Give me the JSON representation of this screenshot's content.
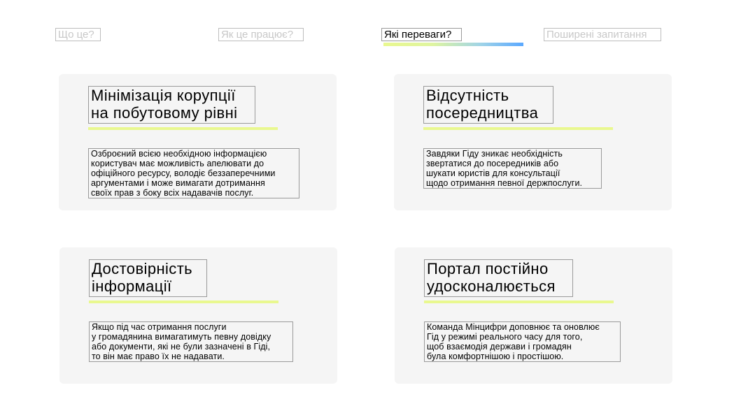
{
  "nav": {
    "tabs": [
      {
        "label": "Що це?",
        "active": false
      },
      {
        "label": "Як це працює?",
        "active": false
      },
      {
        "label": "Які переваги?",
        "active": true
      },
      {
        "label": "Поширені запитання",
        "active": false
      }
    ],
    "active_gradient": [
      "#e9f88f",
      "#5aa8ff"
    ]
  },
  "cards": [
    {
      "title_lines": [
        "Мінімізація корупції",
        "на побутовому рівні"
      ],
      "desc_lines": [
        "Озброєний всією необхідною інформацією",
        "користувач має можливість апелювати до",
        "офіційного ресурсу, володіє беззаперечними",
        "аргументами і може вимагати дотримання",
        "своїх прав з боку всіх надавачів послуг."
      ]
    },
    {
      "title_lines": [
        "Відсутність",
        "посередництва"
      ],
      "desc_lines": [
        "Завдяки Гіду зникає необхідність",
        "звертатися до посередників або",
        "шукати юристів для консультації",
        "щодо отримання певної держпослуги."
      ]
    },
    {
      "title_lines": [
        "Достовірність",
        "інформації"
      ],
      "desc_lines": [
        "Якщо під час отримання послуги",
        "у громадянина вимагатимуть певну довідку",
        "або документи, які не були зазначені в Гіді,",
        "то він має право їх не надавати."
      ]
    },
    {
      "title_lines": [
        "Портал постійно",
        "удосконалюється"
      ],
      "desc_lines": [
        "Команда Мінцифри доповнює та оновлює",
        "Гід у режимі реального часу для того,",
        "щоб взаємодія держави і громадян",
        "була комфортнішою і простішою."
      ]
    }
  ],
  "colors": {
    "card_background": "#f5f5f5",
    "accent_line": "#e9f88f",
    "inactive_tab_text": "#c8c8c8"
  }
}
